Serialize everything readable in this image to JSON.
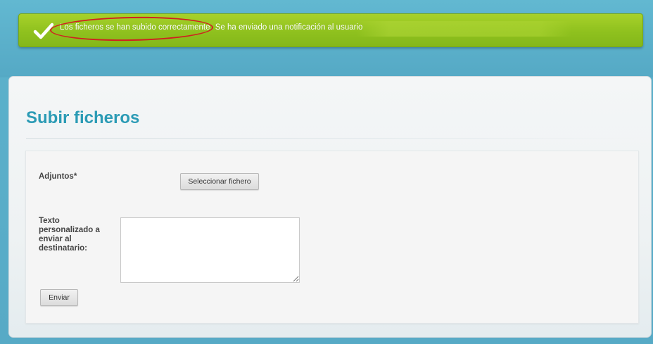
{
  "notification": {
    "part1": "Los ficheros se han subido correctamente.",
    "part2": "Se ha enviado una notificación al usuario",
    "icon": "checkmark-icon",
    "colors": {
      "background": "#96c61f",
      "annotation_circle": "#d02020"
    }
  },
  "page": {
    "title": "Subir ficheros",
    "accent_color": "#2b9bb5"
  },
  "form": {
    "attachments_label": "Adjuntos*",
    "select_file_button": "Seleccionar fichero",
    "custom_text_label": "Texto personalizado a enviar al destinatario:",
    "custom_text_value": "",
    "send_button": "Enviar"
  }
}
